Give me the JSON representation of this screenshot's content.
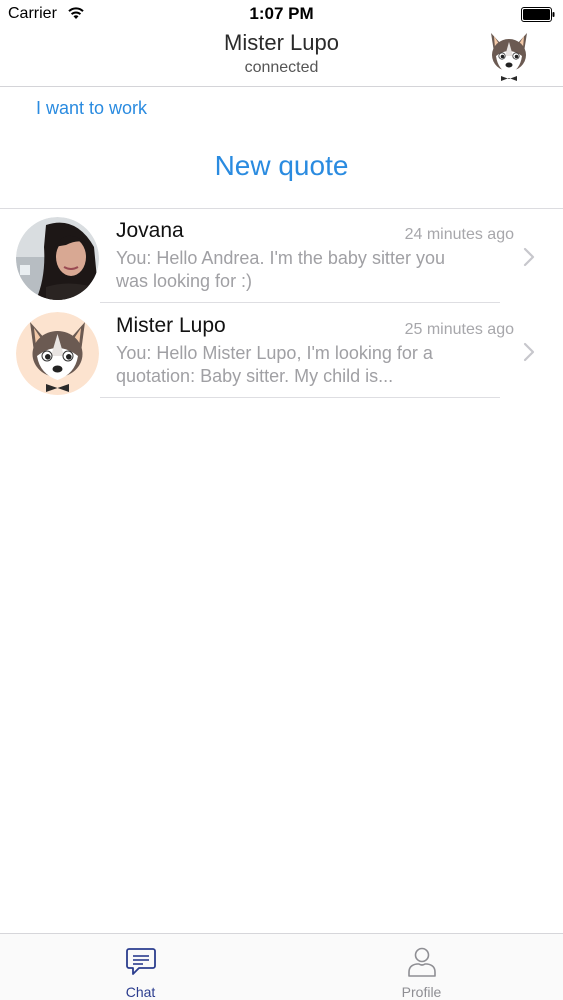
{
  "status_bar": {
    "carrier": "Carrier",
    "time": "1:07 PM",
    "wifi_icon": "wifi-icon",
    "battery_icon": "battery-icon"
  },
  "nav": {
    "title": "Mister Lupo",
    "subtitle": "connected",
    "avatar_icon": "wolf-avatar-icon"
  },
  "actions": {
    "want_to_work": "I want to work",
    "new_quote": "New quote"
  },
  "conversations": [
    {
      "name": "Jovana",
      "time": "24 minutes ago",
      "preview": "You: Hello Andrea. I'm the baby sitter you was looking for :)",
      "avatar": "photo-avatar"
    },
    {
      "name": "Mister Lupo",
      "time": "25 minutes ago",
      "preview": "You: Hello Mister Lupo, I'm looking for a quotation: Baby sitter. My child is...",
      "avatar": "wolf-avatar-icon"
    }
  ],
  "tabs": [
    {
      "label": "Chat",
      "icon": "chat-bubble-icon",
      "active": true
    },
    {
      "label": "Profile",
      "icon": "person-icon",
      "active": false
    }
  ],
  "colors": {
    "accent": "#2a8be0",
    "active_tab": "#2b3d8e",
    "inactive_tab": "#8e8e93",
    "secondary_text": "#a0a0a4"
  }
}
